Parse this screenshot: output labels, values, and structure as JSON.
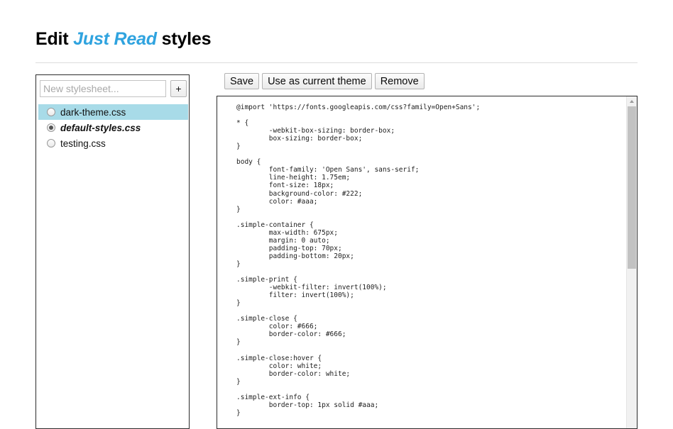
{
  "header": {
    "title_prefix": "Edit",
    "title_brand": "Just Read",
    "title_suffix": "styles"
  },
  "sidebar": {
    "new_stylesheet_placeholder": "New stylesheet...",
    "new_stylesheet_value": "",
    "add_button_label": "+",
    "stylesheets": [
      {
        "name": "dark-theme.css",
        "checked": false,
        "highlighted": true
      },
      {
        "name": "default-styles.css",
        "checked": true,
        "highlighted": false
      },
      {
        "name": "testing.css",
        "checked": false,
        "highlighted": false
      }
    ]
  },
  "toolbar": {
    "save_label": "Save",
    "use_theme_label": "Use as current theme",
    "remove_label": "Remove"
  },
  "editor": {
    "content": "@import 'https://fonts.googleapis.com/css?family=Open+Sans';\n\n* {\n        -webkit-box-sizing: border-box;\n        box-sizing: border-box;\n}\n\nbody {\n        font-family: 'Open Sans', sans-serif;\n        line-height: 1.75em;\n        font-size: 18px;\n        background-color: #222;\n        color: #aaa;\n}\n\n.simple-container {\n        max-width: 675px;\n        margin: 0 auto;\n        padding-top: 70px;\n        padding-bottom: 20px;\n}\n\n.simple-print {\n        -webkit-filter: invert(100%);\n        filter: invert(100%);\n}\n\n.simple-close {\n        color: #666;\n        border-color: #666;\n}\n\n.simple-close:hover {\n        color: white;\n        border-color: white;\n}\n\n.simple-ext-info {\n        border-top: 1px solid #aaa;\n}"
  },
  "colors": {
    "brand_blue": "#2fa3df",
    "selection_highlight": "#a8dbe8",
    "panel_border": "#2b2b2b",
    "scrollbar_thumb": "#c2c2c2"
  }
}
